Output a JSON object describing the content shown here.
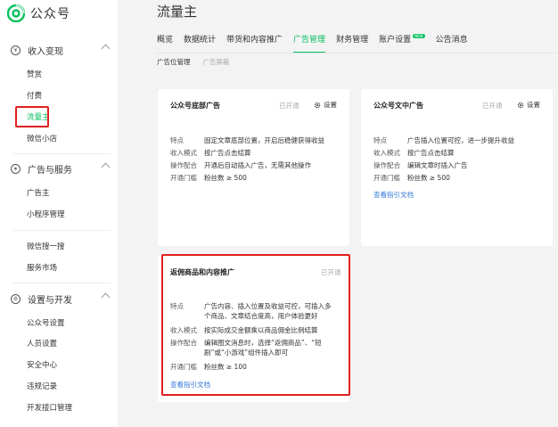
{
  "app": {
    "name": "公众号"
  },
  "sidebar": {
    "sections": [
      {
        "label": "收入变现",
        "items": [
          "赞赏",
          "付费",
          "流量主",
          "微信小店"
        ]
      },
      {
        "label": "广告与服务",
        "items": [
          "广告主",
          "小程序管理",
          "微信搜一搜",
          "服务市场"
        ]
      },
      {
        "label": "设置与开发",
        "items": [
          "公众号设置",
          "人员设置",
          "安全中心",
          "违规记录",
          "开发接口管理"
        ]
      }
    ]
  },
  "page": {
    "title": "流量主",
    "tabs": [
      "概览",
      "数据统计",
      "带货和内容推广",
      "广告管理",
      "财务管理",
      "账户设置",
      "公告消息"
    ],
    "tab_badge": "NEW",
    "subtabs": [
      "广告位管理",
      "广告屏蔽"
    ]
  },
  "cards": [
    {
      "title": "公众号底部广告",
      "status": "已开通",
      "settings": "设置",
      "rows": [
        {
          "k": "特点",
          "v": "固定文章底部位置，开启后稳健获得收益"
        },
        {
          "k": "收入模式",
          "v": "按广告点击结算"
        },
        {
          "k": "操作配合",
          "v": "开通后自动插入广告，无需其他操作"
        },
        {
          "k": "开通门槛",
          "v": "粉丝数 ≥ 500"
        }
      ]
    },
    {
      "title": "公众号文中广告",
      "status": "已开通",
      "settings": "设置",
      "rows": [
        {
          "k": "特点",
          "v": "广告插入位置可控，进一步提升收益"
        },
        {
          "k": "收入模式",
          "v": "按广告点击结算"
        },
        {
          "k": "操作配合",
          "v": "编辑文章时插入广告"
        },
        {
          "k": "开通门槛",
          "v": "粉丝数 ≥ 500"
        }
      ],
      "link": "查看指引文档"
    },
    {
      "title": "返佣商品和内容推广",
      "status": "已开通",
      "rows": [
        {
          "k": "特点",
          "v1": "广告内容、插入位置及收益可控，可插入多",
          "v2": "个商品、文章结合度高，用户体验更好"
        },
        {
          "k": "收入模式",
          "v1": "按实际成交金额乘以商品佣金比例结算"
        },
        {
          "k": "操作配合",
          "v1": "编辑图文消息时，选择“返佣商品”、“短",
          "v2": "剧”或“小游戏”组件插入即可"
        },
        {
          "k": "开通门槛",
          "v1": "粉丝数 ≥ 100"
        }
      ],
      "link": "查看指引文档"
    }
  ],
  "colors": {
    "accent": "#07c160",
    "highlight": "#e02020",
    "link": "#3478d8"
  }
}
